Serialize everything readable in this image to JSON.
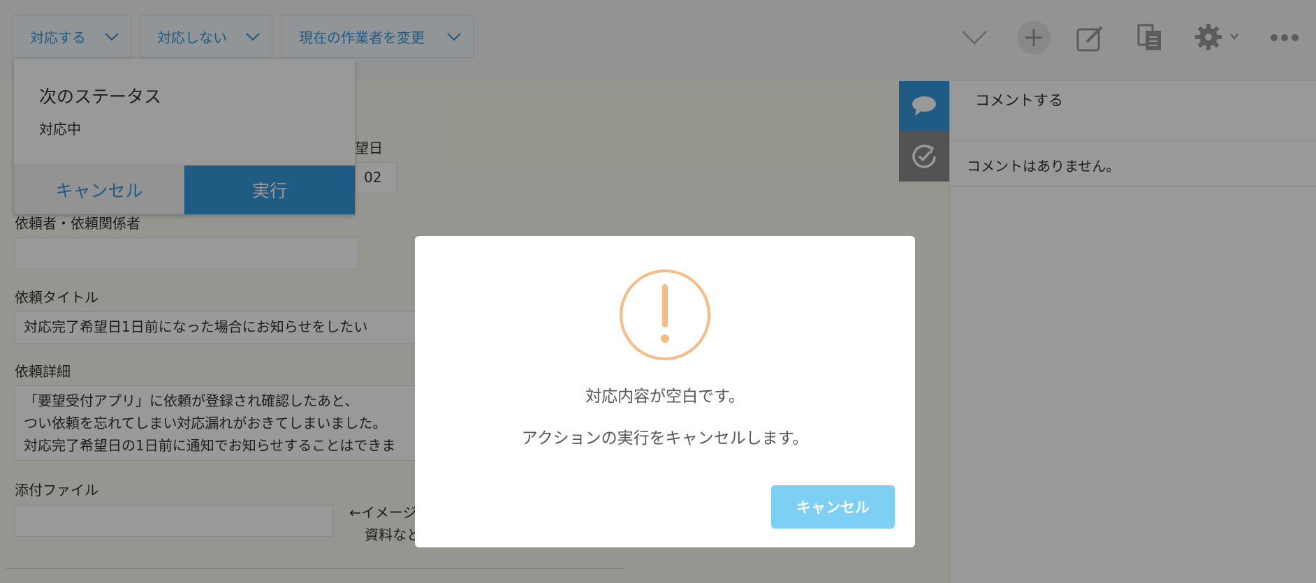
{
  "toolbar": {
    "actions": [
      {
        "label": "対応する"
      },
      {
        "label": "対応しない"
      },
      {
        "label": "現在の作業者を変更"
      }
    ],
    "icons": [
      "collapse-chevron-icon",
      "add-icon",
      "edit-icon",
      "duplicate-icon",
      "settings-icon",
      "more-icon"
    ]
  },
  "status_popup": {
    "title": "次のステータス",
    "value": "対応中",
    "cancel_label": "キャンセル",
    "execute_label": "実行"
  },
  "form": {
    "partial_date_label": "望日",
    "partial_date_value": "02",
    "requester_label": "依頼者・依頼関係者",
    "requester_value": "",
    "title_label": "依頼タイトル",
    "title_value": "対応完了希望日1日前になった場合にお知らせをしたい",
    "detail_label": "依頼詳細",
    "detail_lines": [
      "「要望受付アプリ」に依頼が登録され確認したあと、",
      "つい依頼を忘れてしまい対応漏れがおきてしまいました。",
      "対応完了希望日の1日前に通知でお知らせすることはできま"
    ],
    "attachment_label": "添付ファイル",
    "attachment_note_line1": "←イメージ",
    "attachment_note_line2": "資料なと"
  },
  "comments": {
    "header": "コメントする",
    "empty_text": "コメントはありません。"
  },
  "modal": {
    "message1": "対応内容が空白です。",
    "message2": "アクションの実行をキャンセルします。",
    "cancel_label": "キャンセル",
    "icon": "warning-icon",
    "icon_color": "#f8bb86"
  },
  "colors": {
    "accent": "#3498db",
    "modal_button": "#7ecff4"
  }
}
